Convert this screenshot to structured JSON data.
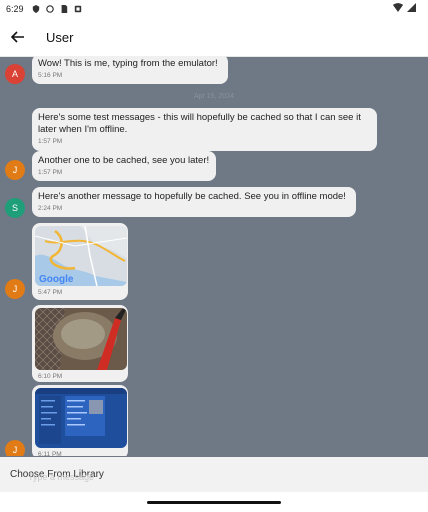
{
  "status": {
    "time": "6:29"
  },
  "app_bar": {
    "title": "User"
  },
  "messages": [
    {
      "avatar": "A",
      "text": "Wow! This is me, typing from the emulator!",
      "time": "5:16 PM"
    },
    {
      "date": "Apr 15, 2024"
    },
    {
      "text": "Here's some test messages - this will hopefully be cached so that I can see it later when I'm offline.",
      "time": "1:57 PM"
    },
    {
      "avatar": "J",
      "text": "Another one to be cached, see you later!",
      "time": "1:57 PM"
    },
    {
      "avatar": "S",
      "text": "Here's another message to hopefully be cached. See you in offline mode!",
      "time": "2:24 PM"
    },
    {
      "avatar": "J",
      "image": "map",
      "time": "5:47 PM",
      "map_label": "Google"
    },
    {
      "image": "photo",
      "time": "6:10 PM"
    },
    {
      "avatar": "J",
      "image": "screenshot",
      "time": "6:11 PM"
    }
  ],
  "bottom_sheet": {
    "option": "Choose From Library"
  },
  "composer": {
    "placeholder": "Type a message"
  },
  "colors": {
    "background": "#6f7885",
    "bubble": "#f0f0f0",
    "avatar_red": "#d94235",
    "avatar_orange": "#e07b16",
    "avatar_green": "#1e9e79"
  }
}
